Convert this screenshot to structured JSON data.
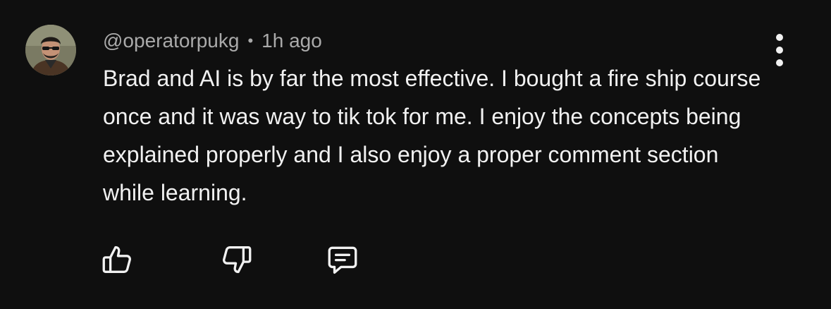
{
  "comment": {
    "author": "@operatorpukg",
    "separator": "•",
    "time": "1h ago",
    "text": "Brad and AI is by far the most effective. I bought a fire ship course once and it was way to tik tok for me. I enjoy the concepts being explained properly and I also enjoy a proper comment section while learning."
  },
  "actions": {
    "like_icon": "thumbs-up-icon",
    "dislike_icon": "thumbs-down-icon",
    "reply_icon": "comment-icon",
    "more_icon": "more-vertical-icon"
  },
  "colors": {
    "background": "#0f0f0f",
    "primary_text": "#f1f1f1",
    "secondary_text": "#aaaaaa"
  }
}
